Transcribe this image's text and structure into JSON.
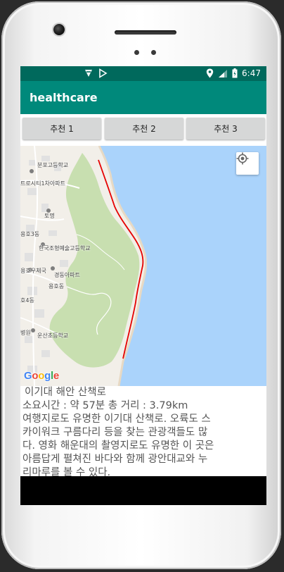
{
  "status_bar": {
    "time": "6:47",
    "left_icons": [
      "app-notification-icon",
      "play-store-icon"
    ],
    "right_icons": [
      "location-icon",
      "signal-icon",
      "battery-icon"
    ]
  },
  "app": {
    "title": "healthcare"
  },
  "tabs": [
    {
      "label": "추천 1"
    },
    {
      "label": "추천 2"
    },
    {
      "label": "추천 3"
    }
  ],
  "map": {
    "labels": [
      "분포고등학교",
      "트로시티1차아파트",
      "토명",
      "용호3동",
      "한국조형예술고등학교",
      "용호우체국",
      "경동아파트",
      "용호동",
      "호4동",
      "운산초등학교",
      "병원"
    ],
    "attribution": "Google",
    "route_color": "#e60000",
    "water_color": "#aad3fb",
    "park_color": "#c8dfb0",
    "land_color": "#f2efe9"
  },
  "route_info": {
    "name": "이기대 해안 산책로",
    "duration_distance": "소요시간 : 약 57분 총 거리 : 3.79km",
    "description_lines": [
      "여행지로도 유명한 이기대 산책로. 오륙도 스",
      "카이워크 구름다리 등을 찾는 관광객들도 많",
      "다. 영화 해운대의 촬영지로도 유명한 이 곳은",
      "아름답게 펼쳐진 바다와 함께 광안대교와 누",
      "리마루를 볼 수 있다."
    ]
  }
}
